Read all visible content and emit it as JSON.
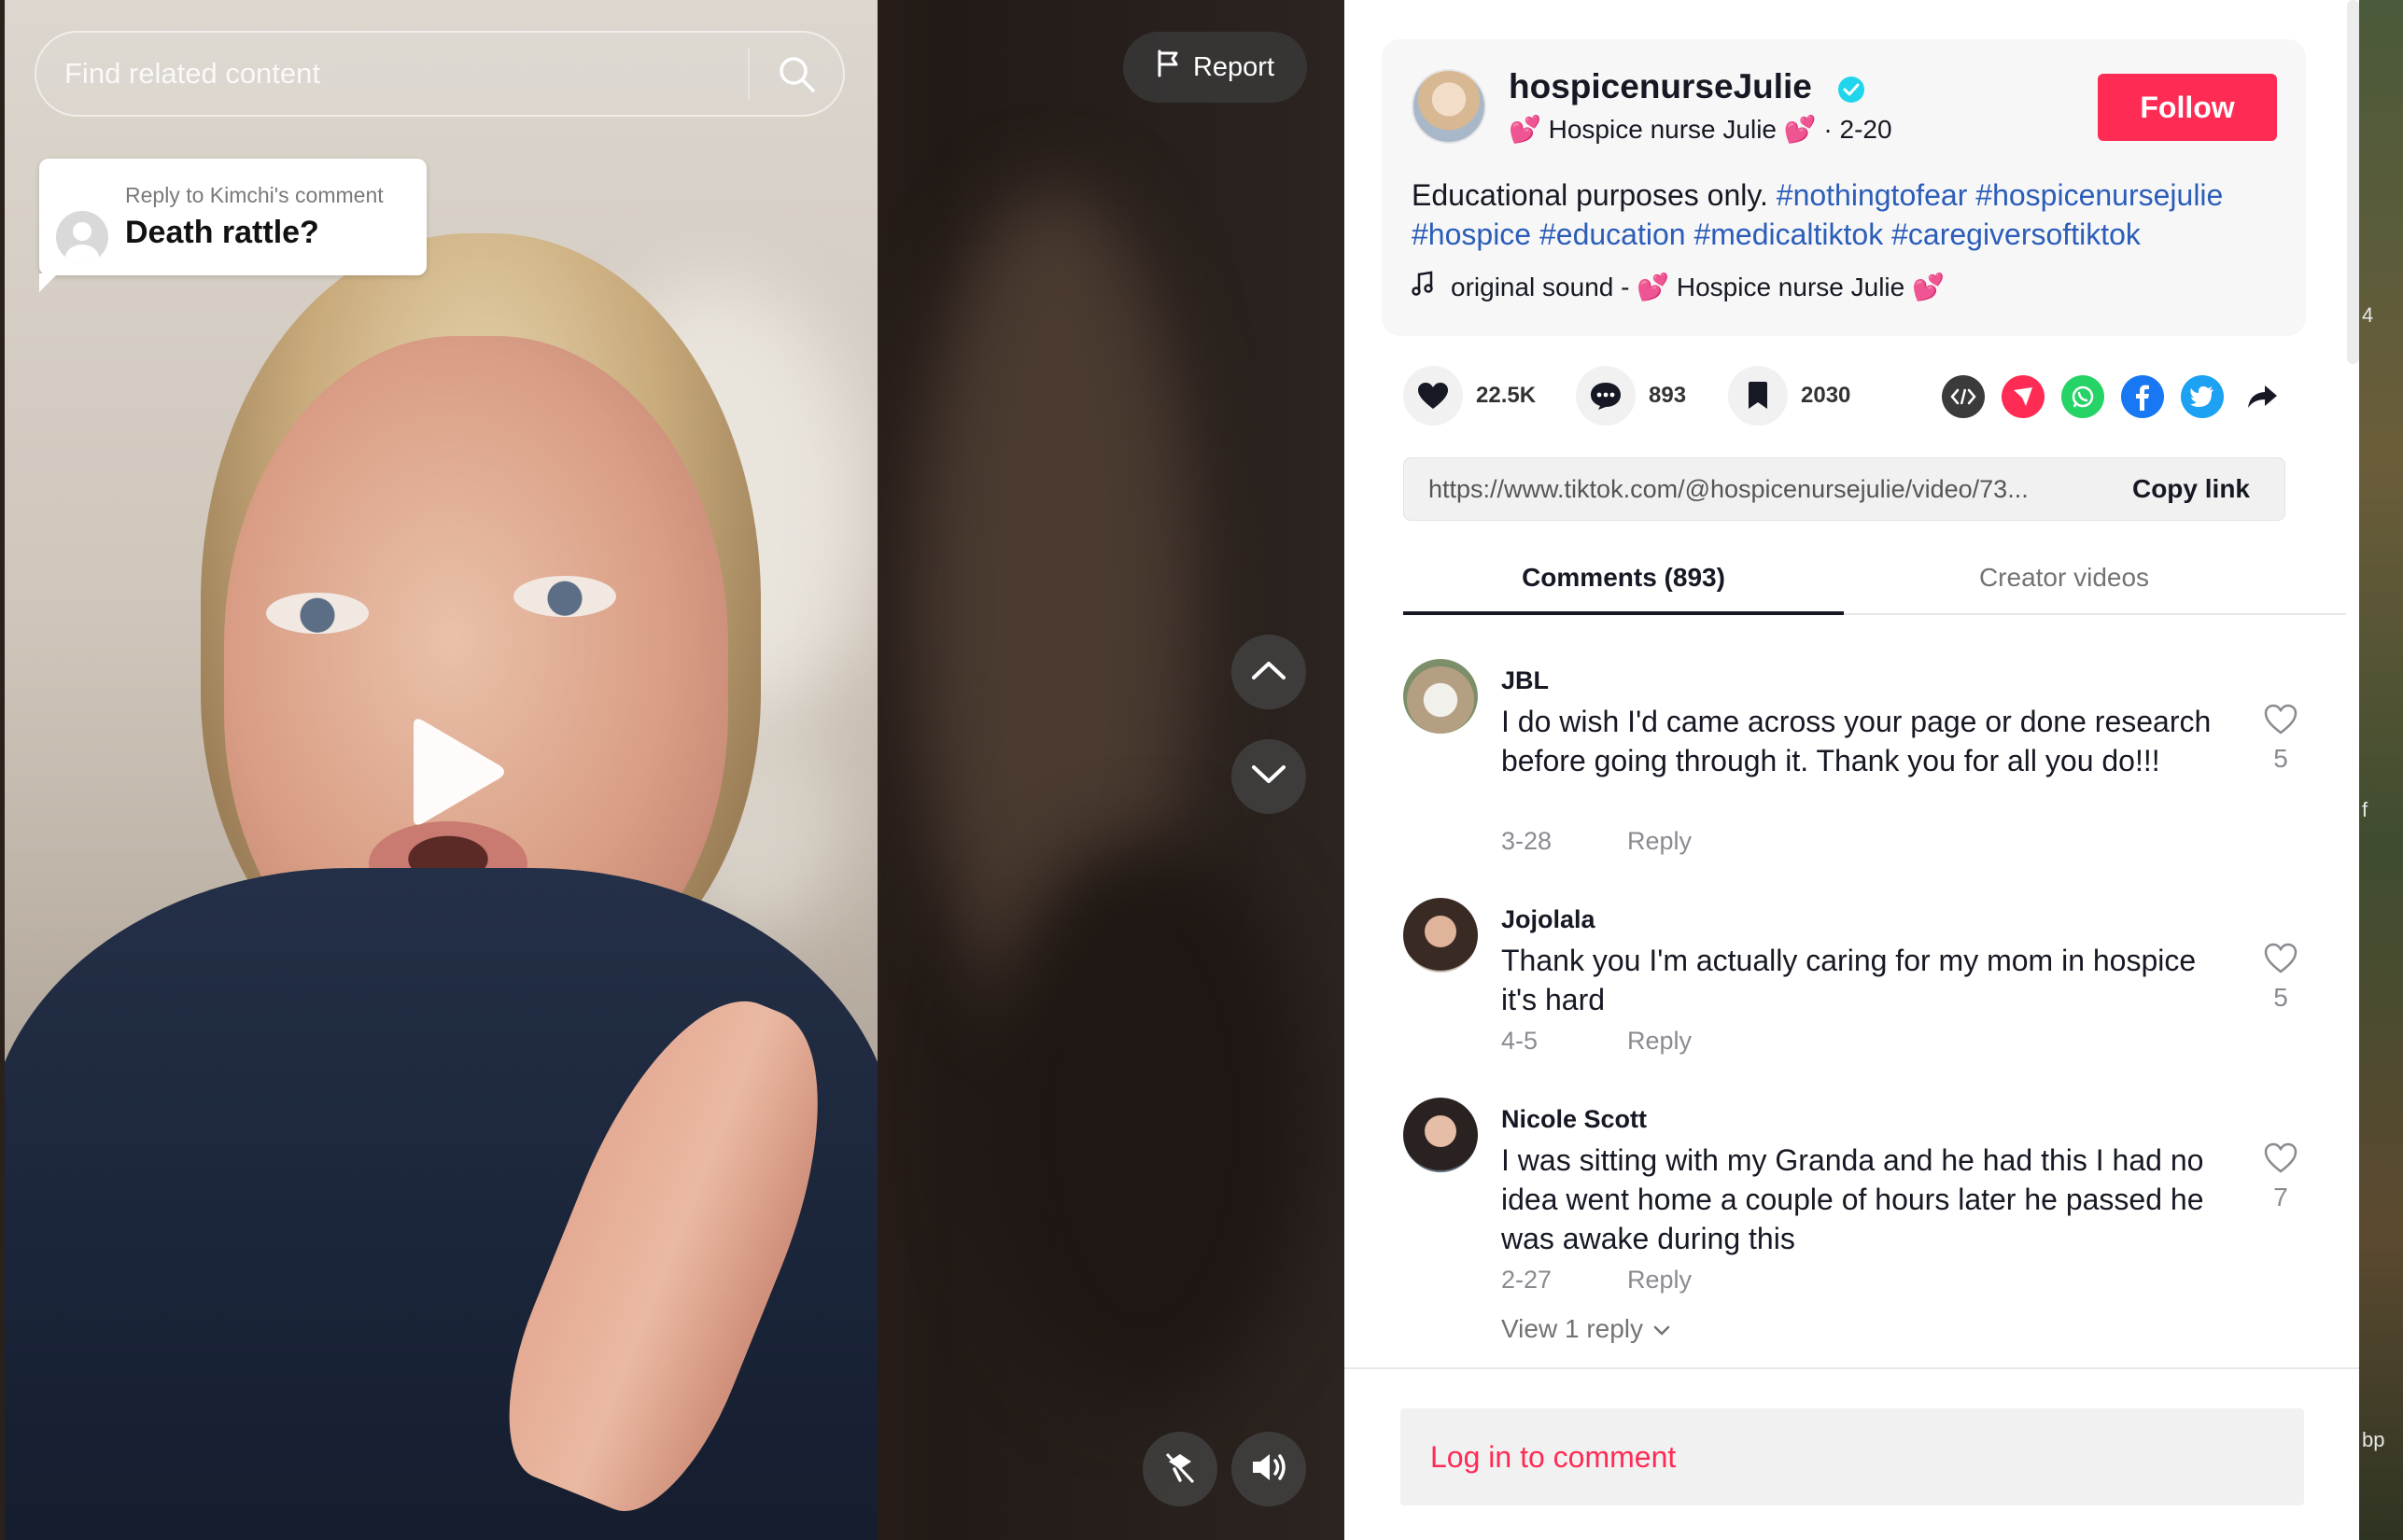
{
  "video": {
    "search_placeholder": "Find related content",
    "report_label": "Report",
    "sticker": {
      "reply_to": "Reply to Kimchi's comment",
      "text": "Death rattle?"
    },
    "icons": {
      "search": "search-icon",
      "play": "play-icon",
      "report": "flag-icon",
      "up": "chevron-up-icon",
      "down": "chevron-down-icon",
      "float": "floating-player-icon",
      "volume": "volume-icon"
    }
  },
  "creator": {
    "handle": "hospicenurseJulie",
    "display_name": "💕 Hospice nurse Julie 💕",
    "date": "2-20",
    "follow_label": "Follow",
    "caption_plain": "Educational purposes only.",
    "hashtags": [
      "#nothingtofear",
      "#hospicenursejulie",
      "#hospice",
      "#education",
      "#medicaltiktok",
      "#caregiversoftiktok"
    ],
    "sound": "original sound - 💕 Hospice nurse Julie 💕"
  },
  "actions": {
    "likes": "22.5K",
    "comments": "893",
    "saves": "2030",
    "share_icons": [
      "embed-icon",
      "send-icon",
      "whatsapp-icon",
      "facebook-icon",
      "twitter-icon",
      "share-arrow-icon"
    ]
  },
  "link": {
    "url": "https://www.tiktok.com/@hospicenursejulie/video/73...",
    "copy_label": "Copy link"
  },
  "tabs": {
    "comments": "Comments (893)",
    "creator_videos": "Creator videos"
  },
  "comments": [
    {
      "user": "JBL",
      "text": "I do wish I'd came across your page or done research before going through it. Thank you for all you do!!!",
      "date": "3-28",
      "reply": "Reply",
      "likes": "5"
    },
    {
      "user": "Jojolala",
      "text": "Thank you I'm actually caring for my mom in hospice it's hard",
      "date": "4-5",
      "reply": "Reply",
      "likes": "5"
    },
    {
      "user": "Nicole Scott",
      "text": "I was sitting with my Granda and he had this I had no idea went home a couple of hours later he passed he was awake during this",
      "date": "2-27",
      "reply": "Reply",
      "likes": "7"
    }
  ],
  "view_reply": "View 1 reply",
  "login_prompt": "Log in to comment",
  "desktop_edge_text": [
    "4",
    "f",
    "bp"
  ],
  "colors": {
    "accent": "#fe2c55",
    "hashtag": "#2b5db9",
    "verified": "#20d5ec"
  }
}
